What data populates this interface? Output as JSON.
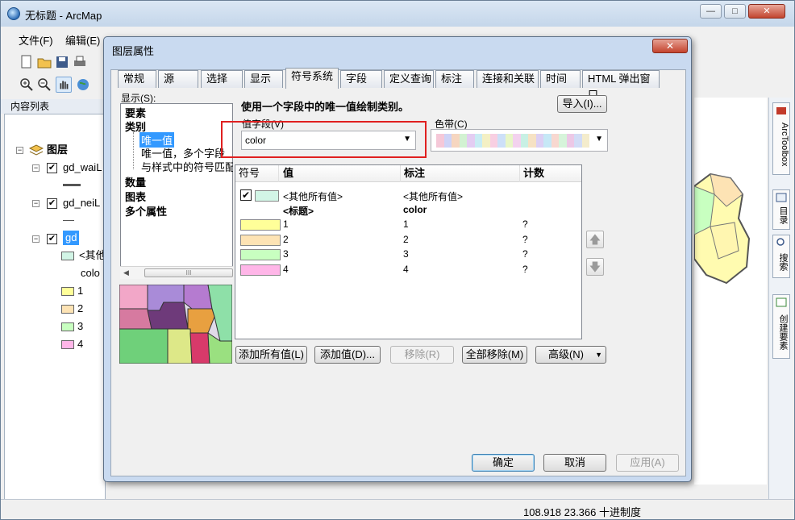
{
  "app": {
    "title": "无标题 - ArcMap"
  },
  "menu": [
    "文件(F)",
    "编辑(E)"
  ],
  "toc": {
    "title": "内容列表",
    "root": "图层",
    "layers": [
      {
        "name": "gd_waiL",
        "checked": true
      },
      {
        "name": "gd_neiL",
        "checked": true
      },
      {
        "name": "gd",
        "checked": true,
        "selected": true
      }
    ],
    "gd_legend": {
      "other": "<其他",
      "field": "colo",
      "classes": [
        {
          "label": "1",
          "color": "#ffff99"
        },
        {
          "label": "2",
          "color": "#fde3b4"
        },
        {
          "label": "3",
          "color": "#c8ffc0"
        },
        {
          "label": "4",
          "color": "#ffb6e8"
        }
      ],
      "other_color": "#d2f5e6"
    }
  },
  "dock": [
    "ArcToolbox",
    "目录",
    "搜索",
    "创建要素"
  ],
  "status": {
    "coords": "108.918  23.366 十进制度"
  },
  "dialog": {
    "title": "图层属性",
    "close_label": "✕",
    "tabs": [
      "常规",
      "源",
      "选择",
      "显示",
      "符号系统",
      "字段",
      "定义查询",
      "标注",
      "连接和关联",
      "时间",
      "HTML 弹出窗口"
    ],
    "active_tab": "符号系统",
    "show_label": "显示(S):",
    "show_items": {
      "features": "要素",
      "categories": "类别",
      "unique": "唯一值",
      "unique_many": "唯一值，多个字段",
      "match_style": "与样式中的符号匹配",
      "quantities": "数量",
      "charts": "图表",
      "multi_attr": "多个属性"
    },
    "scroll_thumb": "III",
    "description": "使用一个字段中的唯一值绘制类别。",
    "import_button": "导入(I)...",
    "value_field_label": "值字段(V)",
    "value_field": "color",
    "color_ramp_label": "色带(C)",
    "ramp_colors": [
      "#f5c8d8",
      "#cfd3f6",
      "#f6d6c0",
      "#d2f2d2",
      "#e3cdf2",
      "#c9ecf4",
      "#f4f0c4",
      "#f8cfe2",
      "#cde0f8",
      "#e8f6c8",
      "#f3d2ee",
      "#c8f0e4",
      "#f6e2c4",
      "#dcd0f4",
      "#c6e8f6",
      "#f8d8d0",
      "#d6f4da",
      "#ecc8e6",
      "#d2dcf6",
      "#f4eccc"
    ],
    "grid": {
      "headers": {
        "symbol": "符号",
        "value": "值",
        "label": "标注",
        "count": "计数"
      },
      "rows": [
        {
          "type": "other",
          "value": "<其他所有值>",
          "label": "<其他所有值>",
          "count": "",
          "color": "#d2f5e6",
          "checked": true
        },
        {
          "type": "heading",
          "value": "<标题>",
          "label": "color",
          "count": ""
        },
        {
          "type": "class",
          "value": "1",
          "label": "1",
          "count": "?",
          "color": "#ffff99"
        },
        {
          "type": "class",
          "value": "2",
          "label": "2",
          "count": "?",
          "color": "#fde3b4"
        },
        {
          "type": "class",
          "value": "3",
          "label": "3",
          "count": "?",
          "color": "#c8ffc0"
        },
        {
          "type": "class",
          "value": "4",
          "label": "4",
          "count": "?",
          "color": "#ffb6e8"
        }
      ]
    },
    "buttons": {
      "add_all": "添加所有值(L)",
      "add_values": "添加值(D)...",
      "remove": "移除(R)",
      "remove_all": "全部移除(M)",
      "advanced": "高级(N)",
      "ok": "确定",
      "cancel": "取消",
      "apply": "应用(A)"
    }
  }
}
